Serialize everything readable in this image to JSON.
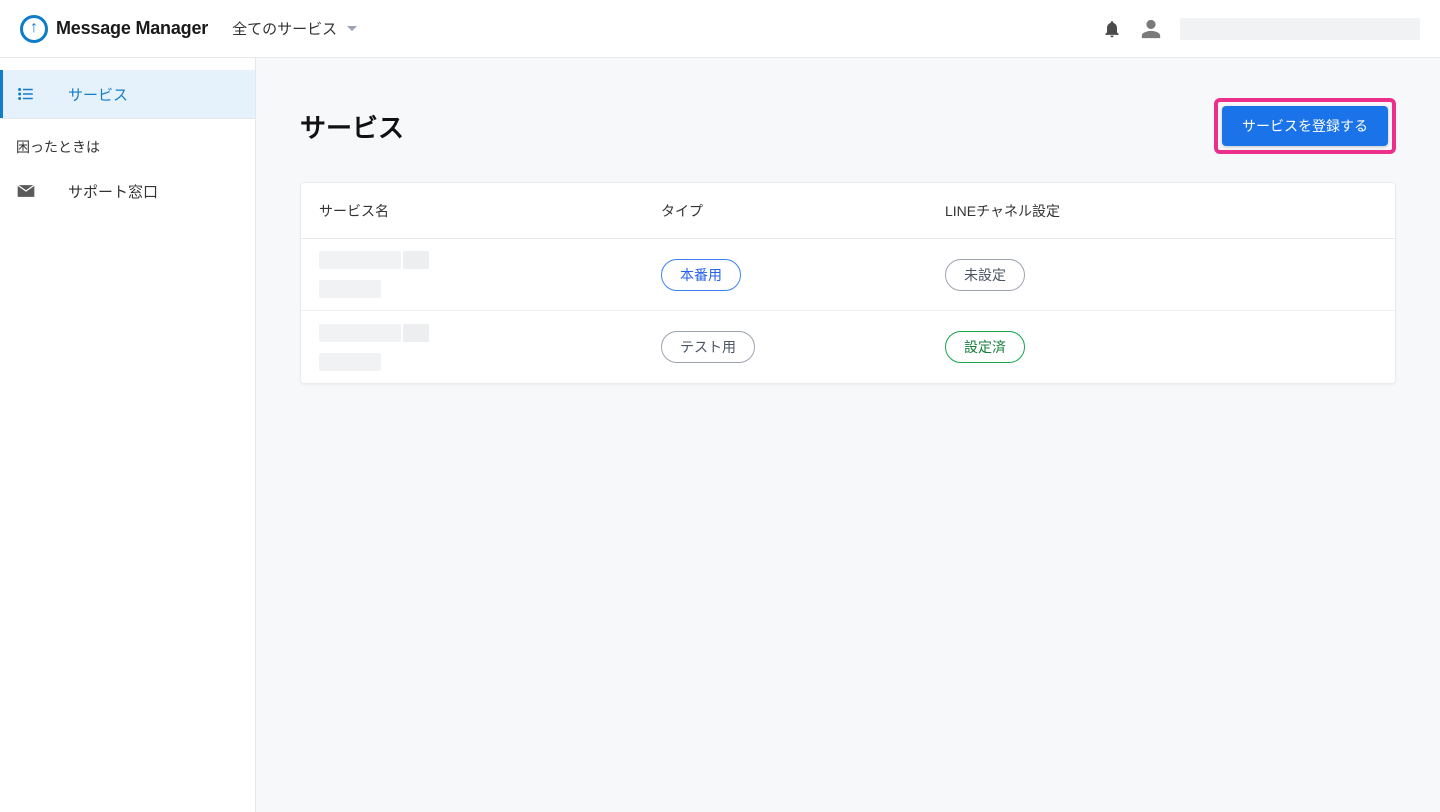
{
  "header": {
    "app_name": "Message Manager",
    "service_selector_label": "全てのサービス"
  },
  "sidebar": {
    "items": [
      {
        "label": "サービス",
        "icon": "list-icon",
        "active": true
      }
    ],
    "section_title": "困ったときは",
    "support_label": "サポート窓口"
  },
  "page": {
    "title": "サービス",
    "register_button": "サービスを登録する"
  },
  "table": {
    "headers": {
      "name": "サービス名",
      "type": "タイプ",
      "status": "LINEチャネル設定"
    },
    "rows": [
      {
        "type_label": "本番用",
        "type_variant": "blue",
        "status_label": "未設定",
        "status_variant": "gray"
      },
      {
        "type_label": "テスト用",
        "type_variant": "gray",
        "status_label": "設定済",
        "status_variant": "green"
      }
    ]
  }
}
